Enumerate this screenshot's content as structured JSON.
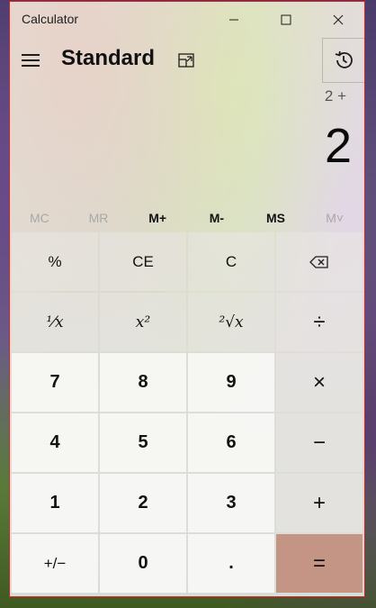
{
  "window": {
    "title": "Calculator"
  },
  "header": {
    "mode": "Standard"
  },
  "display": {
    "expression": "2 +",
    "result": "2"
  },
  "memory": [
    {
      "label": "MC",
      "enabled": false
    },
    {
      "label": "MR",
      "enabled": false
    },
    {
      "label": "M+",
      "enabled": true
    },
    {
      "label": "M-",
      "enabled": true
    },
    {
      "label": "MS",
      "enabled": true
    },
    {
      "label": "M˅",
      "enabled": false
    }
  ],
  "keys": {
    "percent": "%",
    "ce": "CE",
    "c": "C",
    "backspace": "⌫",
    "reciprocal": "⅟x",
    "square": "x²",
    "sqrt": "²√x",
    "divide": "÷",
    "seven": "7",
    "eight": "8",
    "nine": "9",
    "multiply": "×",
    "four": "4",
    "five": "5",
    "six": "6",
    "minus": "−",
    "one": "1",
    "two": "2",
    "three": "3",
    "plus": "+",
    "negate": "+/−",
    "zero": "0",
    "decimal": ".",
    "equals": "="
  },
  "colors": {
    "equals_bg": "#c49484",
    "border_accent": "#e0201c"
  },
  "icons": {
    "menu": "hamburger-icon",
    "keep_on_top": "keep-on-top-icon",
    "history": "history-icon",
    "minimize": "minimize-icon",
    "maximize": "maximize-icon",
    "close": "close-icon"
  }
}
